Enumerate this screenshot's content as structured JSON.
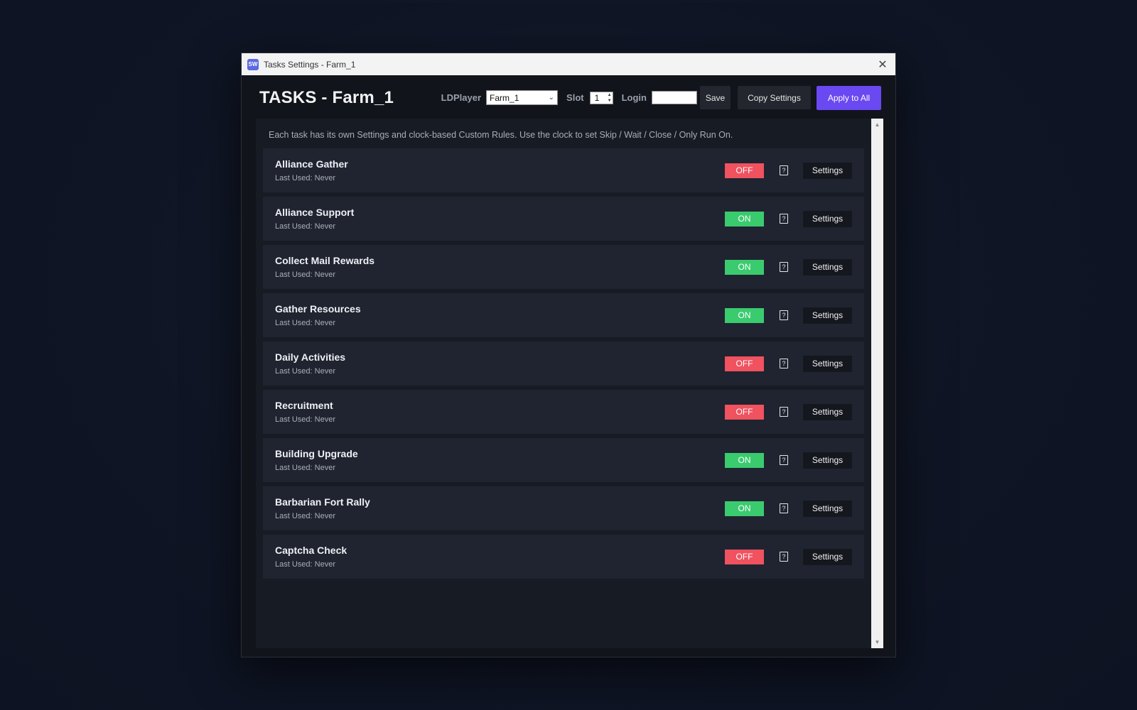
{
  "window": {
    "app_icon_text": "SW",
    "title": "Tasks Settings - Farm_1",
    "close_glyph": "✕"
  },
  "header": {
    "title": "TASKS - Farm_1",
    "ldplayer_label": "LDPlayer",
    "ldplayer_value": "Farm_1",
    "slot_label": "Slot",
    "slot_value": "1",
    "login_label": "Login",
    "login_value": "",
    "save_label": "Save",
    "copy_label": "Copy Settings",
    "apply_label": "Apply to All"
  },
  "description": "Each task has its own Settings and clock-based Custom Rules. Use the clock to set Skip / Wait / Close / Only Run On.",
  "colors": {
    "accent": "#6a48f2",
    "on": "#3bcb6f",
    "off": "#f0525f"
  },
  "tasks": [
    {
      "name": "Alliance Gather",
      "last_used": "Last Used: Never",
      "state": "OFF"
    },
    {
      "name": "Alliance Support",
      "last_used": "Last Used: Never",
      "state": "ON"
    },
    {
      "name": "Collect Mail Rewards",
      "last_used": "Last Used: Never",
      "state": "ON"
    },
    {
      "name": "Gather Resources",
      "last_used": "Last Used: Never",
      "state": "ON"
    },
    {
      "name": "Daily Activities",
      "last_used": "Last Used: Never",
      "state": "OFF"
    },
    {
      "name": "Recruitment",
      "last_used": "Last Used: Never",
      "state": "OFF"
    },
    {
      "name": "Building Upgrade",
      "last_used": "Last Used: Never",
      "state": "ON"
    },
    {
      "name": "Barbarian Fort Rally",
      "last_used": "Last Used: Never",
      "state": "ON"
    },
    {
      "name": "Captcha Check",
      "last_used": "Last Used: Never",
      "state": "OFF"
    }
  ],
  "settings_label": "Settings",
  "help_glyph": "?"
}
